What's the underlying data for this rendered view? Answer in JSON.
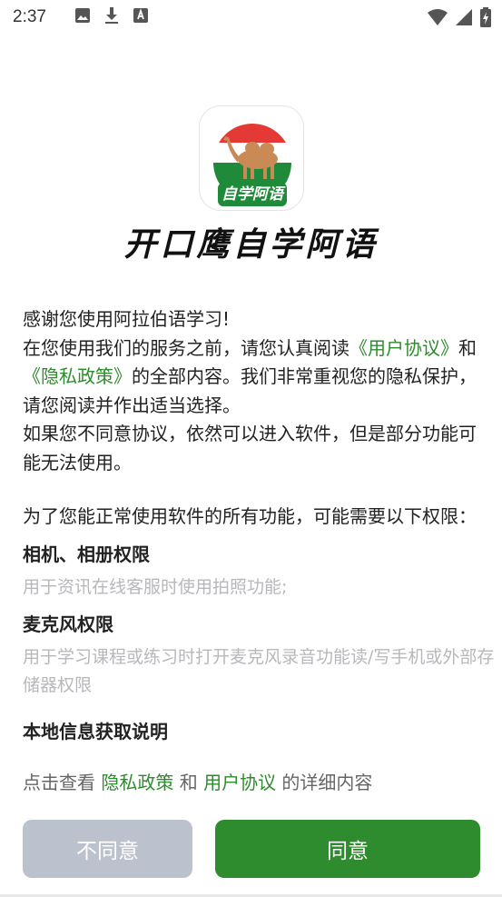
{
  "status_bar": {
    "time": "2:37",
    "left_icons": [
      "image-icon",
      "download-icon",
      "a-box-icon"
    ],
    "right_icons": [
      "wifi-icon",
      "signal-icon",
      "battery-charging-icon"
    ]
  },
  "app": {
    "logo_badge_text": "自学阿语",
    "name": "开口鹰自学阿语"
  },
  "intro": {
    "line1": "感谢您使用阿拉伯语学习!",
    "line2_prefix": "在您使用我们的服务之前，请您认真阅读",
    "user_agreement_link": "《用户协议》",
    "and": "和",
    "privacy_policy_link": "《隐私政策》",
    "line2_suffix": "的全部内容。我们非常重视您的隐私保护，请您阅读并作出适当选择。",
    "line3": "如果您不同意协议，依然可以进入软件，但是部分功能可能无法使用。"
  },
  "permissions": {
    "intro": "为了您能正常使用软件的所有功能，可能需要以下权限：",
    "items": [
      {
        "title": "相机、相册权限",
        "desc": "用于资讯在线客服时使用拍照功能;"
      },
      {
        "title": "麦克风权限",
        "desc": "用于学习课程或练习时打开麦克风录音功能读/写手机或外部存储器权限"
      }
    ],
    "cut_off_title": "本地信息获取说明"
  },
  "footer": {
    "prefix": "点击查看 ",
    "privacy_link": "隐私政策",
    "and": " 和 ",
    "user_link": "用户协议",
    "suffix": " 的详细内容"
  },
  "buttons": {
    "disagree": "不同意",
    "agree": "同意"
  },
  "colors": {
    "accent": "#2e8b2e",
    "disabled_button": "#bcc2cd",
    "muted_text": "#b8b8bc"
  }
}
